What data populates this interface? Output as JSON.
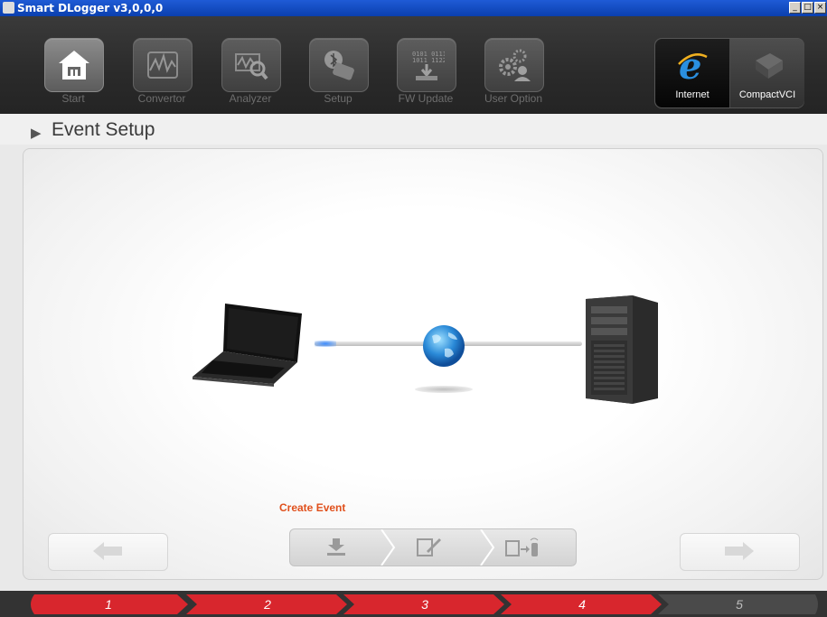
{
  "window": {
    "title": "Smart DLogger v3,0,0,0",
    "controls": [
      "_",
      "□",
      "×"
    ]
  },
  "toolbar": {
    "buttons": [
      {
        "label": "Start",
        "icon": "home-icon"
      },
      {
        "label": "Convertor",
        "icon": "waveform-icon"
      },
      {
        "label": "Analyzer",
        "icon": "analyzer-magnifier-icon"
      },
      {
        "label": "Setup",
        "icon": "bluetooth-device-icon"
      },
      {
        "label": "FW Update",
        "icon": "binary-chip-icon"
      },
      {
        "label": "User Option",
        "icon": "gears-user-icon"
      }
    ],
    "connections": [
      {
        "label": "Internet",
        "icon": "internet-explorer-icon",
        "selected": true
      },
      {
        "label": "CompactVCI",
        "icon": "vci-device-icon",
        "selected": false
      }
    ]
  },
  "section": {
    "title": "Event Setup"
  },
  "main": {
    "create_label": "Create Event",
    "illustration": {
      "left": "laptop-icon",
      "center": "globe-icon",
      "right": "server-tower-icon"
    },
    "steps": [
      "download-icon",
      "edit-icon",
      "transfer-icon"
    ]
  },
  "progress": {
    "steps": [
      "1",
      "2",
      "3",
      "4",
      "5"
    ],
    "current": 4,
    "active_color": "#d8262d",
    "inactive_color": "#4a4a4a"
  }
}
